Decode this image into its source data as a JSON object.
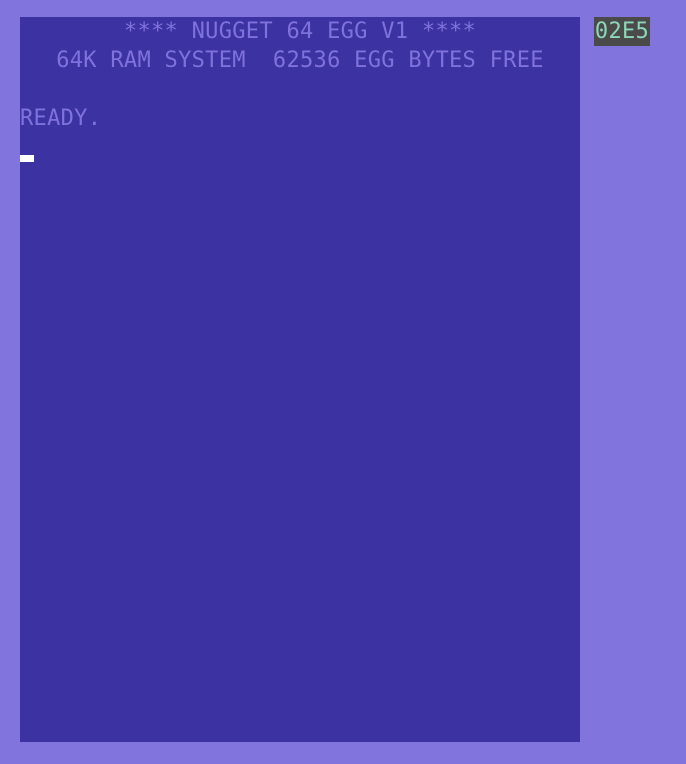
{
  "screen": {
    "title_line": "**** NUGGET 64 EGG V1 ****",
    "info_line": "64K RAM SYSTEM  62536 EGG BYTES FREE",
    "ready_line": "READY."
  },
  "status": {
    "address": "02E5"
  },
  "colors": {
    "border": "#8174dc",
    "screen": "#3c32a1",
    "text": "#8072dc",
    "cursor": "#ffffff",
    "badge_background": "#4a4a4a",
    "badge_text": "#8ed6b8"
  }
}
